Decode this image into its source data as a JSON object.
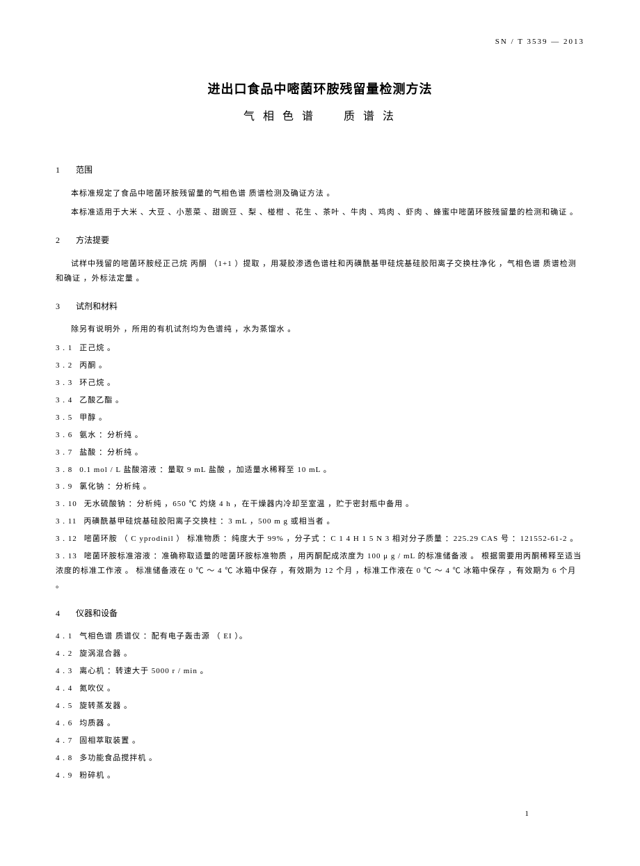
{
  "header": {
    "right": "SN / T   3539   — 2013"
  },
  "title": "进出口食品中嘧菌环胺残留量检测方法",
  "subtitle_left": "气 相 色 谱",
  "subtitle_right": "质 谱 法",
  "s1": {
    "num": "1",
    "head": "范围",
    "p1": "本标准规定了食品中嘧菌环胺残留量的气相色谱                                质谱检测及确证方法                。",
    "p2": "本标准适用于大米            、大豆   、小葱菜      、甜豌豆    、梨   、椪柑    、花生    、茶叶    、牛肉    、鸡肉    、虾肉    、蜂蜜中嘧菌环胺残留量的检测和确证                。"
  },
  "s2": {
    "num": "2",
    "head": "方法提要",
    "p1": "试样中残留的嘧菌环胺经正己烷                        丙酮    （1+1    ）提取    ，用凝胶渗透色谱柱和丙磺酰基甲硅烷基硅胶阳离子交换柱净化            ，气相色谱         质谱检测和确证              ，外标法定量        。"
  },
  "s3": {
    "num": "3",
    "head": "试剂和材料",
    "intro": "除另有说明外          ，所用的有机试剂均为色谱纯                  ，水为蒸馏水        。",
    "items": [
      "正己烷    。",
      "丙酮    。",
      "环己烷    。",
      "乙酸乙酯      。",
      "甲醇   。",
      "氨水   ：分析纯    。",
      "盐酸   ：分析纯    。",
      "0.1 mol   / L   盐酸溶液    ：量取   9 mL   盐酸   ，加适量水稀释至           10 mL    。",
      "氯化钠    ：分析纯    。",
      "无水硫酸钠        ：分析纯    ，650 ℃    灼烧    4 h  ，在干燥器内冷却至室温              ，贮于密封瓶中备用              。",
      "丙磺酰基甲硅烷基硅胶阳离子交换柱                    ：3 mL   ，500 m    g   或相当者      。",
      "嘧菌环胺     （ C yprodinil      ） 标准物质     ：纯度大于       99%    ，分子式      ：C 1 4   H 1 5   N 3    相对分子质量          ：225.29  CAS   号  ：121552-61-2          。",
      "嘧菌环胺标准溶液          ：准确称取适量的嘧菌环胺标准物质                    ，用丙酮配成浓度为            100      μ g / mL    的标准储备液    。   根据需要用丙酮稀释至适当浓度的标准工作液                      。   标准储备液在         0 ℃   ～ 4 ℃   冰箱中保存        ，有效期为    12   个月   ，标准工作液在          0 ℃   ～ 4 ℃   冰箱中保存       ，有效期为        6  个月  。"
    ]
  },
  "s4": {
    "num": "4",
    "head": "仪器和设备",
    "items": [
      "气相色谱        质谱仪    ：配有电子轰击源         （ EI   ）。",
      "旋涡混合器        。",
      "离心机    ：转速大于       5000 r     / min    。",
      "氮吹仪    。",
      "旋转蒸发器        。",
      "均质器    。",
      "固相萃取装置        。",
      "多功能食品搅拌机            。",
      "粉碎机    。"
    ]
  },
  "page": "1"
}
